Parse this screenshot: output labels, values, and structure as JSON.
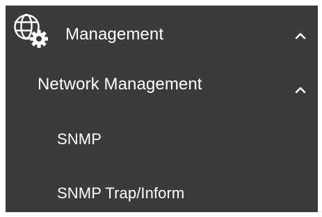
{
  "menu": {
    "management": {
      "label": "Management",
      "icon": "globe-gear-icon",
      "expanded": true
    },
    "network_management": {
      "label": "Network Management",
      "expanded": true
    },
    "items": [
      {
        "label": "SNMP"
      },
      {
        "label": "SNMP Trap/Inform"
      }
    ]
  },
  "colors": {
    "panel_background": "#3b3b3b",
    "text": "#ffffff"
  }
}
